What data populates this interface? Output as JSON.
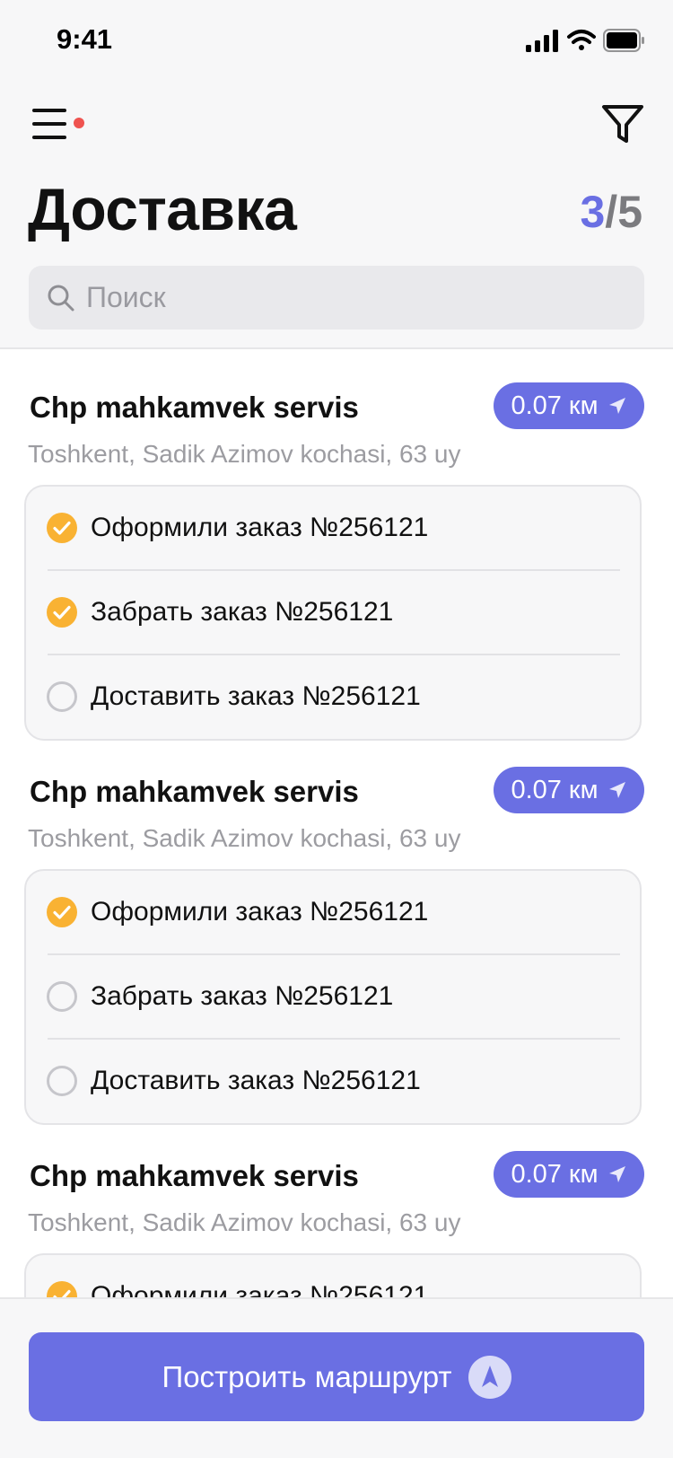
{
  "status_bar": {
    "time": "9:41"
  },
  "header": {
    "title": "Доставка",
    "counter_current": "3",
    "counter_total": "/5",
    "menu_has_badge": true,
    "badge_color": "#ef5350"
  },
  "search": {
    "placeholder": "Поиск",
    "value": ""
  },
  "deliveries": [
    {
      "name": "Chp mahkamvek servis",
      "distance": "0.07 км",
      "address": "Toshkent, Sadik Azimov kochasi, 63 uy",
      "tasks": [
        {
          "label": "Оформили заказ №256121",
          "done": true
        },
        {
          "label": "Забрать заказ №256121",
          "done": true
        },
        {
          "label": "Доставить заказ №256121",
          "done": false
        }
      ]
    },
    {
      "name": "Chp mahkamvek servis",
      "distance": "0.07 км",
      "address": "Toshkent, Sadik Azimov kochasi, 63 uy",
      "tasks": [
        {
          "label": "Оформили заказ №256121",
          "done": true
        },
        {
          "label": "Забрать заказ №256121",
          "done": false
        },
        {
          "label": "Доставить заказ №256121",
          "done": false
        }
      ]
    },
    {
      "name": "Chp mahkamvek servis",
      "distance": "0.07 км",
      "address": "Toshkent, Sadik Azimov kochasi, 63 uy",
      "tasks": [
        {
          "label": "Оформили заказ №256121",
          "done": true
        }
      ]
    }
  ],
  "footer": {
    "route_button_label": "Построить маршрурт"
  },
  "colors": {
    "accent": "#6a6fe3",
    "check_done": "#f9b233",
    "check_empty_border": "#c6c6cb"
  },
  "icons": {
    "menu": "hamburger-icon",
    "filter": "filter-icon",
    "search": "search-icon",
    "distance": "location-arrow-icon",
    "done": "check-circle-icon",
    "pending": "empty-circle-icon",
    "route": "navigation-icon"
  }
}
